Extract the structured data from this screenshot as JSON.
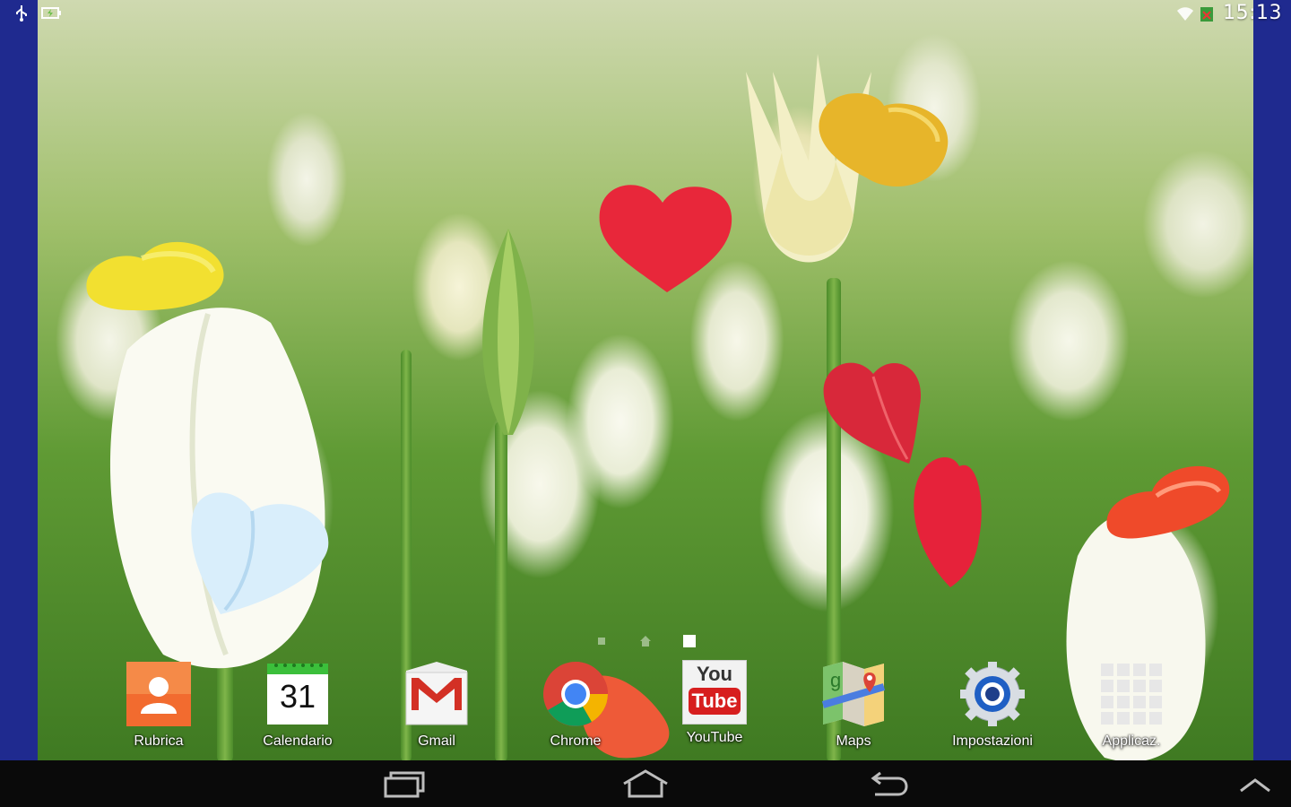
{
  "status_bar": {
    "time": "15:13",
    "left_icons": [
      "usb-icon",
      "battery-charging-icon"
    ],
    "right_icons": [
      "wifi-icon",
      "sim-icon"
    ]
  },
  "home": {
    "page_count": 3,
    "current_page": 3
  },
  "dock": {
    "apps": [
      {
        "label": "Rubrica",
        "icon": "contacts-icon"
      },
      {
        "label": "Calendario",
        "icon": "calendar-icon",
        "icon_text": "31"
      },
      {
        "label": "Gmail",
        "icon": "gmail-icon"
      },
      {
        "label": "Chrome",
        "icon": "chrome-icon"
      },
      {
        "label": "YouTube",
        "icon": "youtube-icon",
        "icon_text_top": "You",
        "icon_text_bottom": "Tube"
      },
      {
        "label": "Maps",
        "icon": "maps-icon"
      },
      {
        "label": "Impostazioni",
        "icon": "settings-icon"
      },
      {
        "label": "Applicaz.",
        "icon": "apps-grid-icon"
      }
    ]
  },
  "nav_bar": {
    "buttons": [
      "recent-apps",
      "home",
      "back"
    ]
  },
  "colors": {
    "side_bars": "#1f2a8f",
    "nav_bar": "#0a0a0a",
    "heart_red": "#e8273a",
    "heart_yellow": "#f2e030",
    "heart_gold": "#e7b52a",
    "heart_blue": "#d9eefb",
    "heart_orange": "#ef4a2a"
  }
}
